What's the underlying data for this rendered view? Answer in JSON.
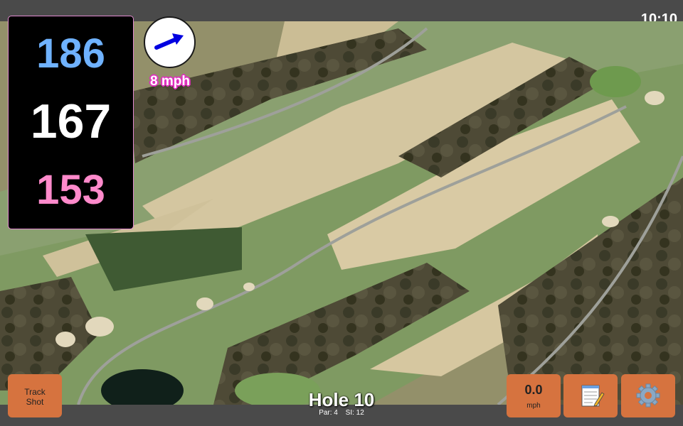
{
  "status": {
    "clock": "10:10"
  },
  "distances": {
    "back": {
      "value": "186",
      "color": "#6fb2ff"
    },
    "middle": {
      "value": "167",
      "color": "#ffffff"
    },
    "front": {
      "value": "153",
      "color": "#ff8acb"
    }
  },
  "wind_indicator": {
    "label": "8 mph",
    "icon": "wind-direction-arrow-icon",
    "arrow_color": "#0000e0"
  },
  "hole": {
    "title": "Hole 10",
    "par": "Par: 4",
    "stroke_index": "SI: 12"
  },
  "buttons": {
    "track_shot": {
      "line1": "Track",
      "line2": "Shot"
    },
    "wind_speed": {
      "value": "0.0",
      "unit": "mph"
    },
    "notes": {
      "icon": "notepad-icon"
    },
    "settings": {
      "icon": "gear-icon"
    }
  },
  "colors": {
    "button_bg": "#d6733f",
    "bar_bg": "#4a4a4a"
  }
}
